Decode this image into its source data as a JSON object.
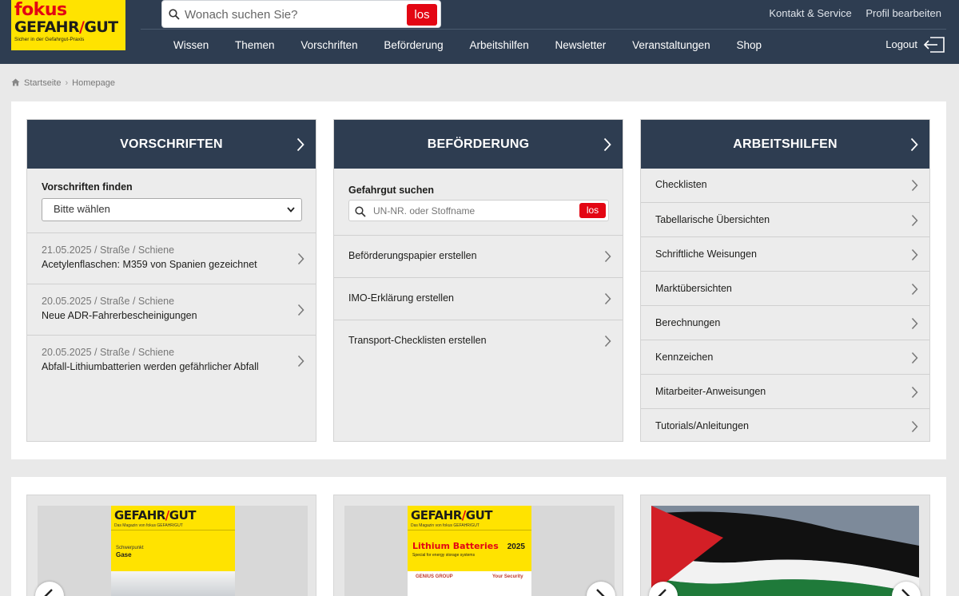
{
  "header": {
    "logo": {
      "line1": "fokus",
      "line2a": "GEFAHR",
      "line2b": "/",
      "line2c": "GUT",
      "tagline": "Sicher in der Gefahrgut-Praxis"
    },
    "search": {
      "placeholder": "Wonach suchen Sie?",
      "button": "los"
    },
    "toplinks": [
      "Kontakt & Service",
      "Profil bearbeiten"
    ],
    "nav": [
      "Wissen",
      "Themen",
      "Vorschriften",
      "Beförderung",
      "Arbeitshilfen",
      "Newsletter",
      "Veranstaltungen",
      "Shop"
    ],
    "logout": "Logout"
  },
  "breadcrumb": [
    "Startseite",
    "Homepage"
  ],
  "cards": {
    "vorschriften": {
      "title": "VORSCHRIFTEN",
      "subtitle": "Vorschriften finden",
      "select": "Bitte wählen",
      "items": [
        {
          "meta": "21.05.2025 / Straße / Schiene",
          "title": "Acetylenflaschen: M359 von Spanien gezeichnet"
        },
        {
          "meta": "20.05.2025 / Straße / Schiene",
          "title": "Neue ADR-Fahrerbescheinigungen"
        },
        {
          "meta": "20.05.2025 / Straße / Schiene",
          "title": "Abfall-Lithiumbatterien werden gefährlicher Abfall"
        }
      ]
    },
    "befoerderung": {
      "title": "BEFÖRDERUNG",
      "subtitle": "Gefahrgut suchen",
      "search_placeholder": "UN-NR. oder Stoffname",
      "search_button": "los",
      "items": [
        "Beförderungspapier erstellen",
        "IMO-Erklärung erstellen",
        "Transport-Checklisten erstellen"
      ]
    },
    "arbeitshilfen": {
      "title": "ARBEITSHILFEN",
      "items": [
        "Checklisten",
        "Tabellarische Übersichten",
        "Schriftliche Weisungen",
        "Marktübersichten",
        "Berechnungen",
        "Kennzeichen",
        "Mitarbeiter-Anweisungen",
        "Tutorials/Anleitungen"
      ]
    }
  },
  "magazines": [
    {
      "title_a": "GEFAHR",
      "title_b": "/",
      "title_c": "GUT",
      "sub": "Das Magazin von fokus GEFAHR/GUT",
      "topic_label": "Schwerpunkt",
      "topic": "Gase"
    },
    {
      "title_a": "GEFAHR",
      "title_b": "/",
      "title_c": "GUT",
      "sub": "Das Magazin von fokus GEFAHR/GUT",
      "headline": "Lithium Batteries",
      "year": "2025",
      "strap": "Special for energy storage systems",
      "sponsor": "GENIUS GROUP",
      "sponsor2": "Your Security"
    }
  ],
  "colors": {
    "header_bg": "#2e3d51",
    "accent_red": "#e30613",
    "logo_yellow": "#ffe300"
  }
}
